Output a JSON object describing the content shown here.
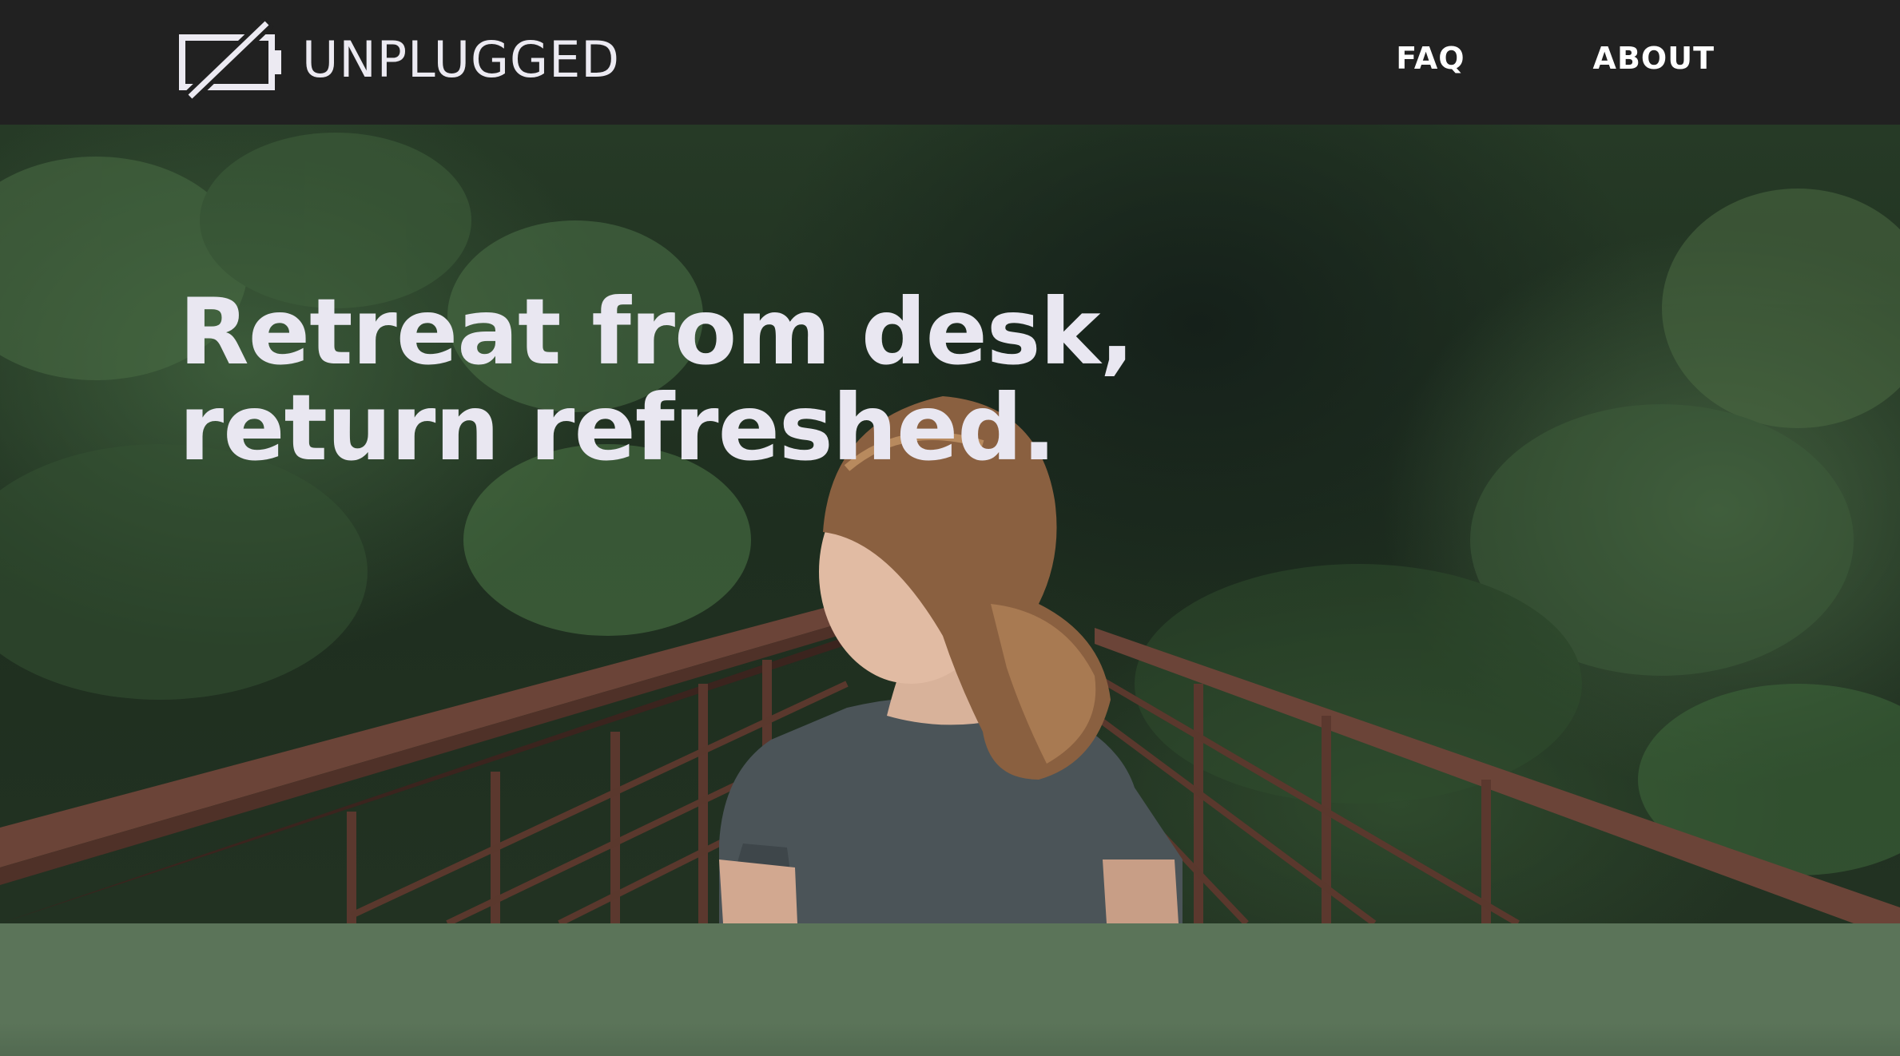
{
  "brand": {
    "name": "UNPLUGGED",
    "logo_icon": "unplugged-battery-icon"
  },
  "nav": {
    "items": [
      {
        "label": "FAQ"
      },
      {
        "label": "ABOUT"
      }
    ]
  },
  "hero": {
    "headline_line1": "Retreat from desk,",
    "headline_line2": "return refreshed.",
    "image": "woman-on-forest-bridge-photo"
  },
  "colors": {
    "navbar_bg": "#212121",
    "nav_text": "#ffffff",
    "headline_text": "#e9e7f1",
    "band_bg": "#5b7459"
  }
}
